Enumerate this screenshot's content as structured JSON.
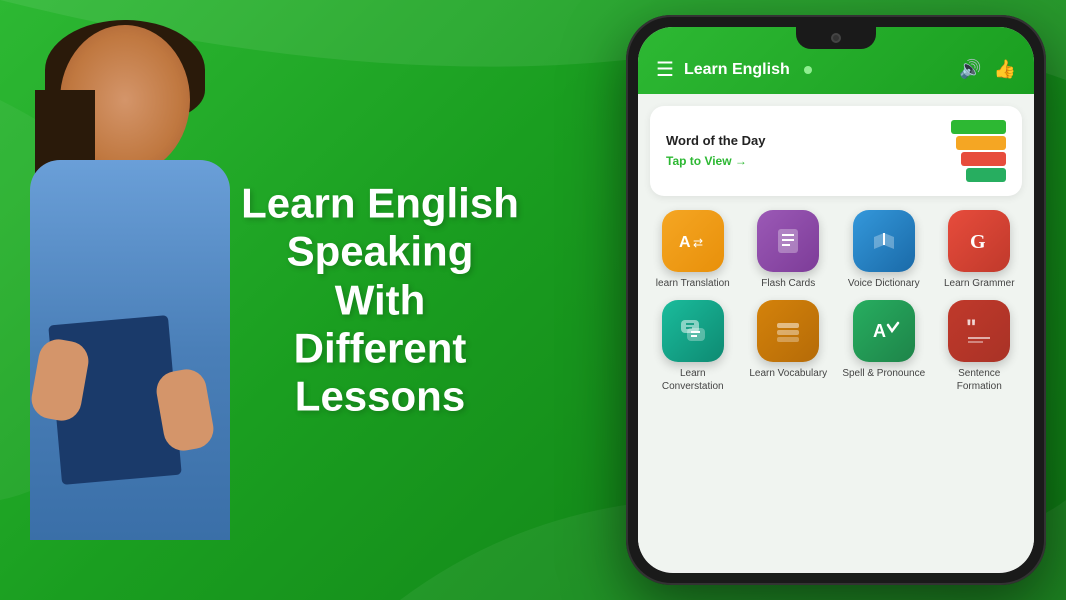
{
  "background": {
    "gradient_start": "#2db833",
    "gradient_end": "#0f7a14"
  },
  "headline": {
    "line1": "Learn English",
    "line2": "Speaking",
    "line3": "With",
    "line4": "Different",
    "line5": "Lessons"
  },
  "phone": {
    "header": {
      "title": "Learn English",
      "menu_icon": "☰",
      "sound_icon": "🔊",
      "like_icon": "👍"
    },
    "wotd_card": {
      "title": "Word of the Day",
      "link_text": "Tap to View →"
    },
    "icons": [
      {
        "label": "learn Translation",
        "icon_char": "A↔",
        "color_class": "icon-orange"
      },
      {
        "label": "Flash Cards",
        "icon_char": "📋",
        "color_class": "icon-purple"
      },
      {
        "label": "Voice Dictionary",
        "icon_char": "📖",
        "color_class": "icon-blue"
      },
      {
        "label": "Learn Grammer",
        "icon_char": "G",
        "color_class": "icon-pink"
      },
      {
        "label": "Learn Converstation",
        "icon_char": "💬",
        "color_class": "icon-teal"
      },
      {
        "label": "Learn Vocabulary",
        "icon_char": "📚",
        "color_class": "icon-amber"
      },
      {
        "label": "Spell & Pronounce",
        "icon_char": "A✓",
        "color_class": "icon-green"
      },
      {
        "label": "Sentence Formation",
        "icon_char": "❝❞",
        "color_class": "icon-red"
      }
    ]
  }
}
